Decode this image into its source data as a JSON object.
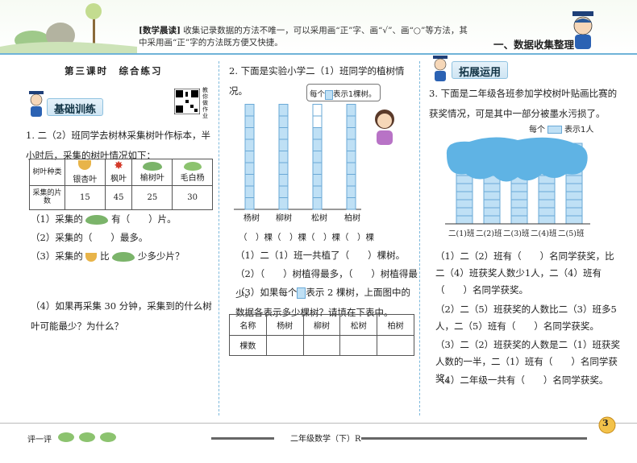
{
  "header": {
    "reading_label": "[数学晨读]",
    "reading_text": "收集记录数据的方法不唯一，可以采用画“正”字、画“√”、画“○”等方法，其中采用画“正”字的方法既方便又快捷。",
    "unit_title": "一、数据收集整理"
  },
  "left": {
    "lesson_title": "第三课时　综合练习",
    "section_tag": "基础训练",
    "qr_label": "教你做作业",
    "q1_text": "1. 二（2）班同学去树林采集树叶作标本，半小时后，采集的树叶情况如下：",
    "table_header_top": "树叶种类",
    "table_header_bottom": "采集的片数",
    "leaf_names": [
      "银杏叶",
      "枫叶",
      "榆树叶",
      "毛白杨"
    ],
    "leaf_counts": [
      "15",
      "45",
      "25",
      "30"
    ],
    "q1_1a": "（1）采集的",
    "q1_1b": "有（　　）片。",
    "q1_2a": "（2）采集的（　　）最多。",
    "q1_3a": "（3）采集的",
    "q1_3b": "比",
    "q1_3c": "少多少片？",
    "q1_4": "（4）如果再采集 30 分钟，采集到的什么树叶可能最少？为什么？"
  },
  "middle": {
    "q2_text": "2. 下面是实验小学二（1）班同学的植树情况。",
    "legend_pre": "每个",
    "legend_post": "表示1棵树。",
    "trees": [
      "杨树",
      "柳树",
      "松树",
      "柏树"
    ],
    "bar_values": [
      9,
      9,
      7,
      9
    ],
    "blank_row": "（　）棵（　）棵（　）棵（　）棵",
    "q2_1": "（1）二（1）班一共植了（　　）棵树。",
    "q2_2": "（2）（　　）树植得最多，（　　）树植得最少。",
    "q2_3a": "（3）如果每个",
    "q2_3b": "表示 2 棵树，上面图中的数据各表示多少棵树？请填在下表中。",
    "table2_headers": [
      "名称",
      "杨树",
      "柳树",
      "松树",
      "柏树"
    ],
    "table2_row_label": "棵数"
  },
  "right": {
    "section_tag": "拓展运用",
    "q3_text": "3. 下面是二年级各班参加学校树叶贴画比赛的获奖情况，可是其中一部分被墨水污损了。",
    "legend_pre": "每个",
    "legend_post": "表示1人",
    "classes": [
      "二(1)班",
      "二(2)班",
      "二(3)班",
      "二(4)班",
      "二(5)班"
    ],
    "q3_1": "（1）二（2）班有（　　）名同学获奖，比二（4）班获奖人数少1人，二（4）班有（　　）名同学获奖。",
    "q3_2": "（2）二（5）班获奖的人数比二（3）班多5人，二（5）班有（　　）名同学获奖。",
    "q3_3": "（3）二（2）班获奖的人数是二（1）班获奖人数的一半，二（1）班有（　　）名同学获奖。",
    "q3_4": "（4）二年级一共有（　　）名同学获奖。"
  },
  "footer": {
    "eval_label": "评一评",
    "book_label": "二年级数学（下）R",
    "page_number": "3"
  }
}
